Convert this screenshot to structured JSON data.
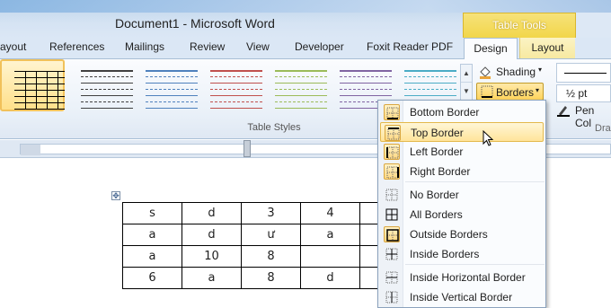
{
  "window": {
    "title": "Document1  -  Microsoft Word",
    "contextual_tab_group": "Table Tools"
  },
  "tabs": [
    {
      "label": "ayout"
    },
    {
      "label": "References"
    },
    {
      "label": "Mailings"
    },
    {
      "label": "Review"
    },
    {
      "label": "View"
    },
    {
      "label": "Developer"
    },
    {
      "label": "Foxit Reader PDF"
    },
    {
      "label": "Design",
      "active": true
    },
    {
      "label": "Layout"
    }
  ],
  "ribbon": {
    "group_label": "Table Styles",
    "shading_label": "Shading",
    "borders_label": "Borders",
    "line_weight": "½ pt",
    "pen_color_label": "Pen Col",
    "draw_group_label": "Dra",
    "style_colors": [
      "#000000",
      "#404040",
      "#4f81bd",
      "#c0504d",
      "#9bbb59",
      "#8064a2",
      "#4bacc6"
    ]
  },
  "borders_menu": {
    "items": [
      {
        "label": "Bottom Border",
        "icon": "bottom-border-icon"
      },
      {
        "label": "Top Border",
        "icon": "top-border-icon",
        "highlighted": true
      },
      {
        "label": "Left Border",
        "icon": "left-border-icon"
      },
      {
        "label": "Right Border",
        "icon": "right-border-icon"
      },
      {
        "label": "No Border",
        "icon": "no-border-icon"
      },
      {
        "label": "All Borders",
        "icon": "all-borders-icon"
      },
      {
        "label": "Outside Borders",
        "icon": "outside-borders-icon"
      },
      {
        "label": "Inside Borders",
        "icon": "inside-borders-icon"
      },
      {
        "label": "Inside Horizontal Border",
        "icon": "inside-horizontal-border-icon"
      },
      {
        "label": "Inside Vertical Border",
        "icon": "inside-vertical-border-icon"
      }
    ]
  },
  "document": {
    "table": [
      [
        "s",
        "d",
        "3",
        "4"
      ],
      [
        "a",
        "d",
        "ư",
        "a"
      ],
      [
        "a",
        "10",
        "8",
        ""
      ],
      [
        "6",
        "a",
        "8",
        "d"
      ]
    ]
  }
}
